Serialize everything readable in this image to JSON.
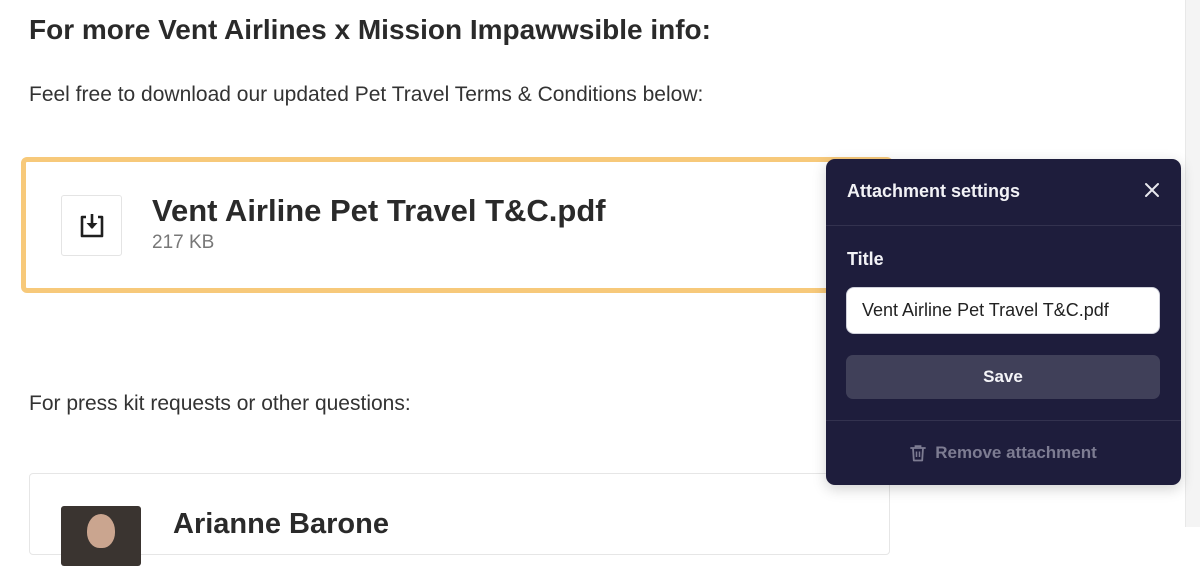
{
  "article": {
    "heading": "For more Vent Airlines x Mission Impawwsible info:",
    "download_prompt": "Feel free to download our updated Pet Travel Terms & Conditions below:",
    "press_prompt": "For press kit requests or other questions:"
  },
  "attachment": {
    "file_name": "Vent Airline Pet Travel T&C.pdf",
    "file_size": "217 KB",
    "icon": "download-icon",
    "highlight_color": "#f7c97a"
  },
  "contact": {
    "name": "Arianne Barone"
  },
  "settings_panel": {
    "title": "Attachment settings",
    "title_field_label": "Title",
    "title_field_value": "Vent Airline Pet Travel T&C.pdf",
    "save_label": "Save",
    "remove_label": "Remove attachment",
    "background_color": "#1e1d3c"
  }
}
